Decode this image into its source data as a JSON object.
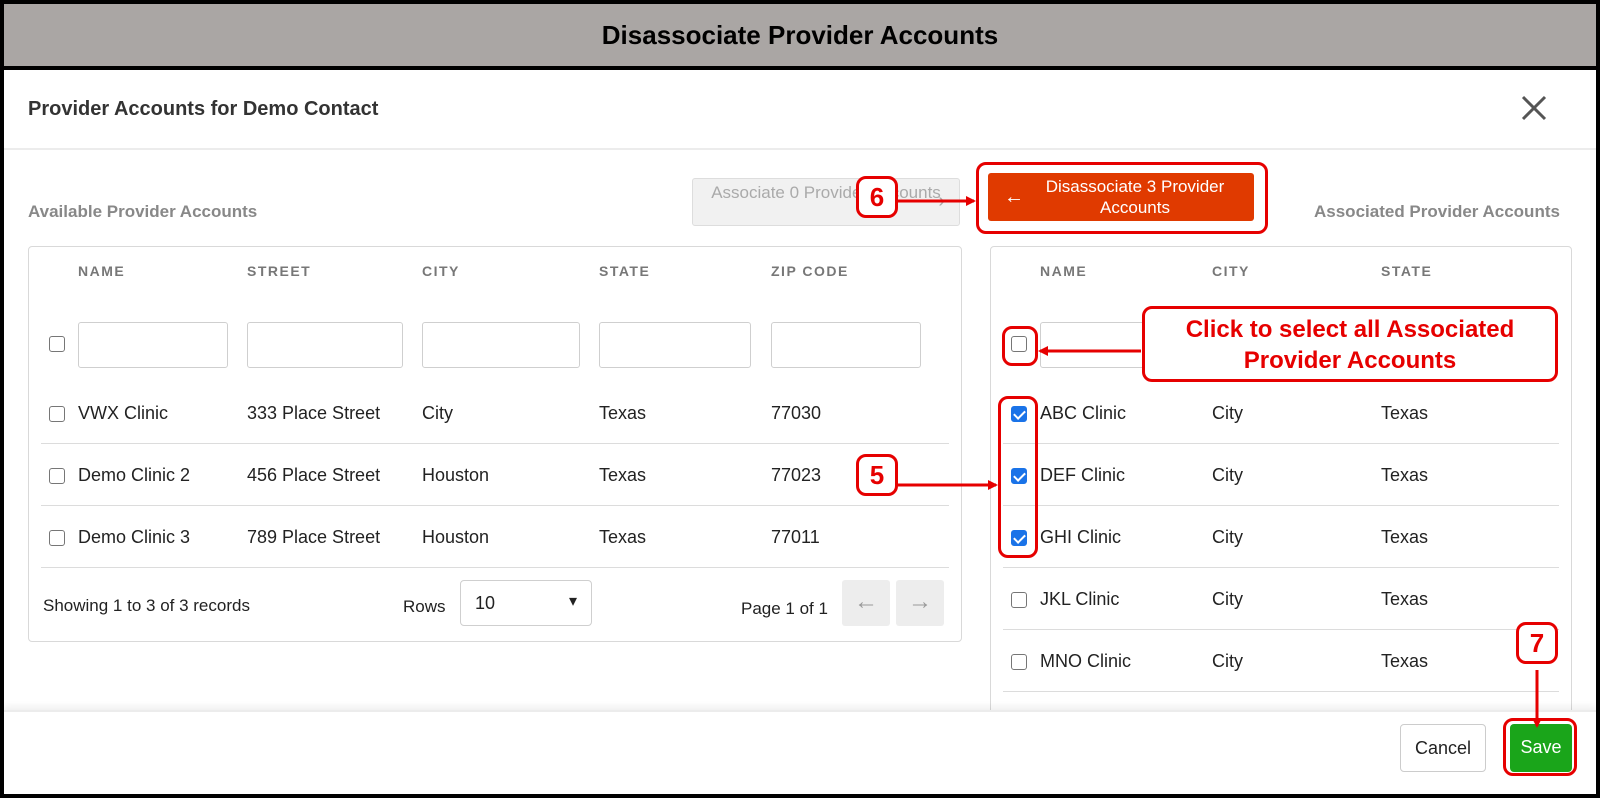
{
  "banner": {
    "title": "Disassociate Provider Accounts"
  },
  "modal": {
    "title": "Provider Accounts for Demo Contact"
  },
  "available": {
    "label": "Available Provider Accounts",
    "columns": [
      "NAME",
      "STREET",
      "CITY",
      "STATE",
      "ZIP CODE"
    ],
    "rows": [
      {
        "name": "VWX Clinic",
        "street": "333 Place Street",
        "city": "City",
        "state": "Texas",
        "zip": "77030"
      },
      {
        "name": "Demo Clinic 2",
        "street": "456 Place Street",
        "city": "Houston",
        "state": "Texas",
        "zip": "77023"
      },
      {
        "name": "Demo Clinic 3",
        "street": "789 Place Street",
        "city": "Houston",
        "state": "Texas",
        "zip": "77011"
      }
    ],
    "showing": "Showing 1 to 3 of 3 records",
    "rows_label": "Rows",
    "rows_value": "10",
    "page_info": "Page 1 of 1"
  },
  "associated": {
    "label": "Associated Provider Accounts",
    "columns": [
      "NAME",
      "CITY",
      "STATE"
    ],
    "rows": [
      {
        "name": "ABC Clinic",
        "city": "City",
        "state": "Texas",
        "checked": true
      },
      {
        "name": "DEF Clinic",
        "city": "City",
        "state": "Texas",
        "checked": true
      },
      {
        "name": "GHI Clinic",
        "city": "City",
        "state": "Texas",
        "checked": true
      },
      {
        "name": "JKL Clinic",
        "city": "City",
        "state": "Texas",
        "checked": false
      },
      {
        "name": "MNO Clinic",
        "city": "City",
        "state": "Texas",
        "checked": false
      }
    ]
  },
  "buttons": {
    "associate": "Associate 0 Provider Accounts",
    "disassociate": "Disassociate 3 Provider Accounts",
    "cancel": "Cancel",
    "save": "Save"
  },
  "annotations": {
    "callout": "Click to select all Associated Provider Accounts",
    "badge_5": "5",
    "badge_6": "6",
    "badge_7": "7"
  },
  "colors": {
    "accent_red": "#e60000",
    "disassociate_bg": "#e03a00",
    "save_bg": "#1aa51a",
    "checkbox_blue": "#1a73e8"
  }
}
